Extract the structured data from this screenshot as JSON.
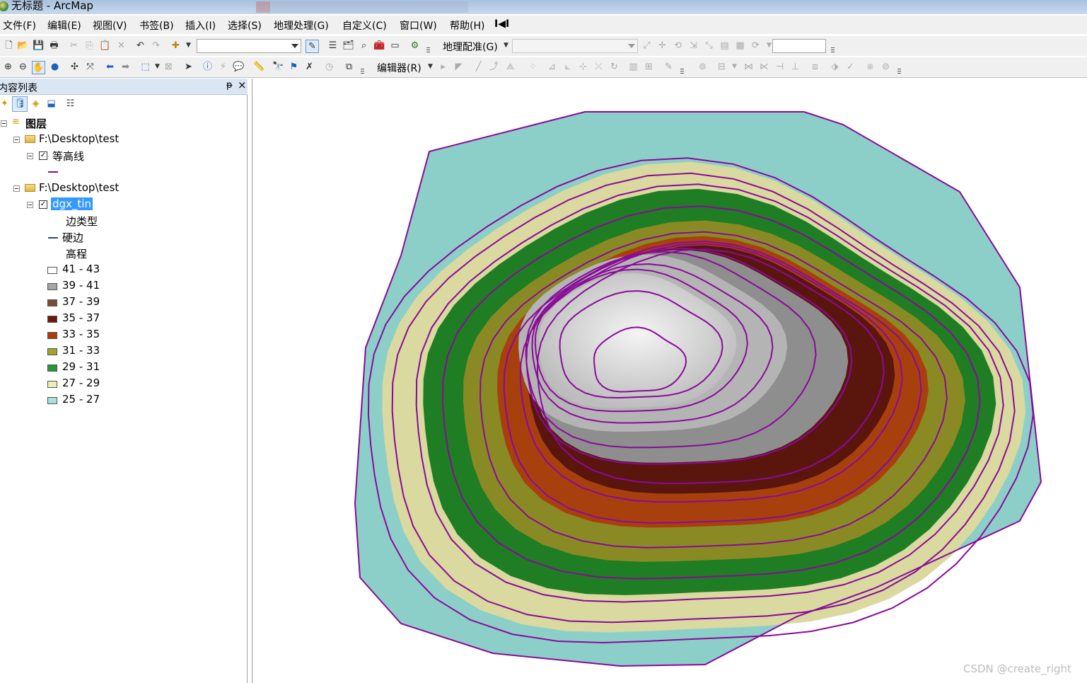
{
  "window": {
    "title": "无标题 - ArcMap"
  },
  "menu": [
    "文件(F)",
    "编辑(E)",
    "视图(V)",
    "书签(B)",
    "插入(I)",
    "选择(S)",
    "地理处理(G)",
    "自定义(C)",
    "窗口(W)",
    "帮助(H)"
  ],
  "toolbar": {
    "georef_label": "地理配准(G)",
    "editor_label": "编辑器(R)"
  },
  "toc": {
    "title": "内容列表",
    "root_label": "图层",
    "groups": [
      {
        "path": "F:\\Desktop\\test",
        "layer": "等高线",
        "line_color": "#7b0f8f"
      },
      {
        "path": "F:\\Desktop\\test",
        "layer": "dgx_tin"
      }
    ],
    "edge_type_label": "边类型",
    "hard_edge_label": "硬边",
    "elevation_label": "高程",
    "classes": [
      {
        "label": "41 - 43",
        "color": "#ffffff"
      },
      {
        "label": "39 - 41",
        "color": "#a6a6a6"
      },
      {
        "label": "37 - 39",
        "color": "#7a4a32"
      },
      {
        "label": "35 - 37",
        "color": "#6b1a0a"
      },
      {
        "label": "33 - 35",
        "color": "#b03a06"
      },
      {
        "label": "31 - 33",
        "color": "#a4a32a"
      },
      {
        "label": "29 - 31",
        "color": "#239a2f"
      },
      {
        "label": "27 - 29",
        "color": "#ecefb2"
      },
      {
        "label": "25 - 27",
        "color": "#a8e2dc"
      }
    ]
  },
  "map": {
    "contour_color": "#8a0a9a"
  },
  "watermark": "CSDN @create_right"
}
